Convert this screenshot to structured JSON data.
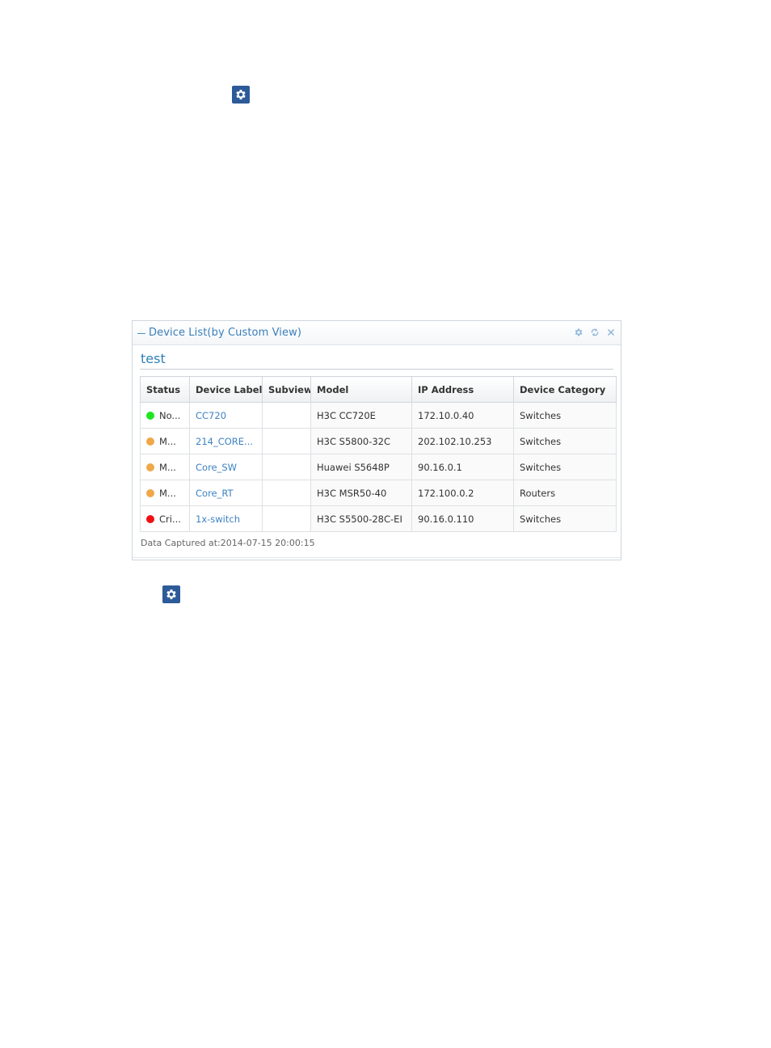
{
  "portlet": {
    "title": "Device List(by Custom View)",
    "view_name": "test",
    "footer": "Data Captured at:2014-07-15 20:00:15"
  },
  "table": {
    "columns": [
      "Status",
      "Device Label",
      "Subview",
      "Model",
      "IP Address",
      "Device Category"
    ],
    "rows": [
      {
        "status": "No...",
        "status_color": "#1ee61e",
        "label": "CC720",
        "subview": "",
        "model": "H3C CC720E",
        "ip": "172.10.0.40",
        "category": "Switches"
      },
      {
        "status": "M...",
        "status_color": "#f0a848",
        "label": "214_CORE...",
        "subview": "",
        "model": "H3C S5800-32C",
        "ip": "202.102.10.253",
        "category": "Switches"
      },
      {
        "status": "M...",
        "status_color": "#f0a848",
        "label": "Core_SW",
        "subview": "",
        "model": "Huawei S5648P",
        "ip": "90.16.0.1",
        "category": "Switches"
      },
      {
        "status": "M...",
        "status_color": "#f0a848",
        "label": "Core_RT",
        "subview": "",
        "model": "H3C MSR50-40",
        "ip": "172.100.0.2",
        "category": "Routers"
      },
      {
        "status": "Cri...",
        "status_color": "#ee1111",
        "label": "1x-switch",
        "subview": "",
        "model": "H3C S5500-28C-EI",
        "ip": "90.16.0.110",
        "category": "Switches"
      }
    ]
  },
  "icons": {
    "top_gear": "gear-icon",
    "bottom_gear": "gear-icon",
    "header_tools": [
      "settings-icon",
      "refresh-icon",
      "close-icon"
    ]
  },
  "colors": {
    "gear_bg": "#2d5a98",
    "title": "#3a7fba",
    "link": "#3d82c4"
  }
}
